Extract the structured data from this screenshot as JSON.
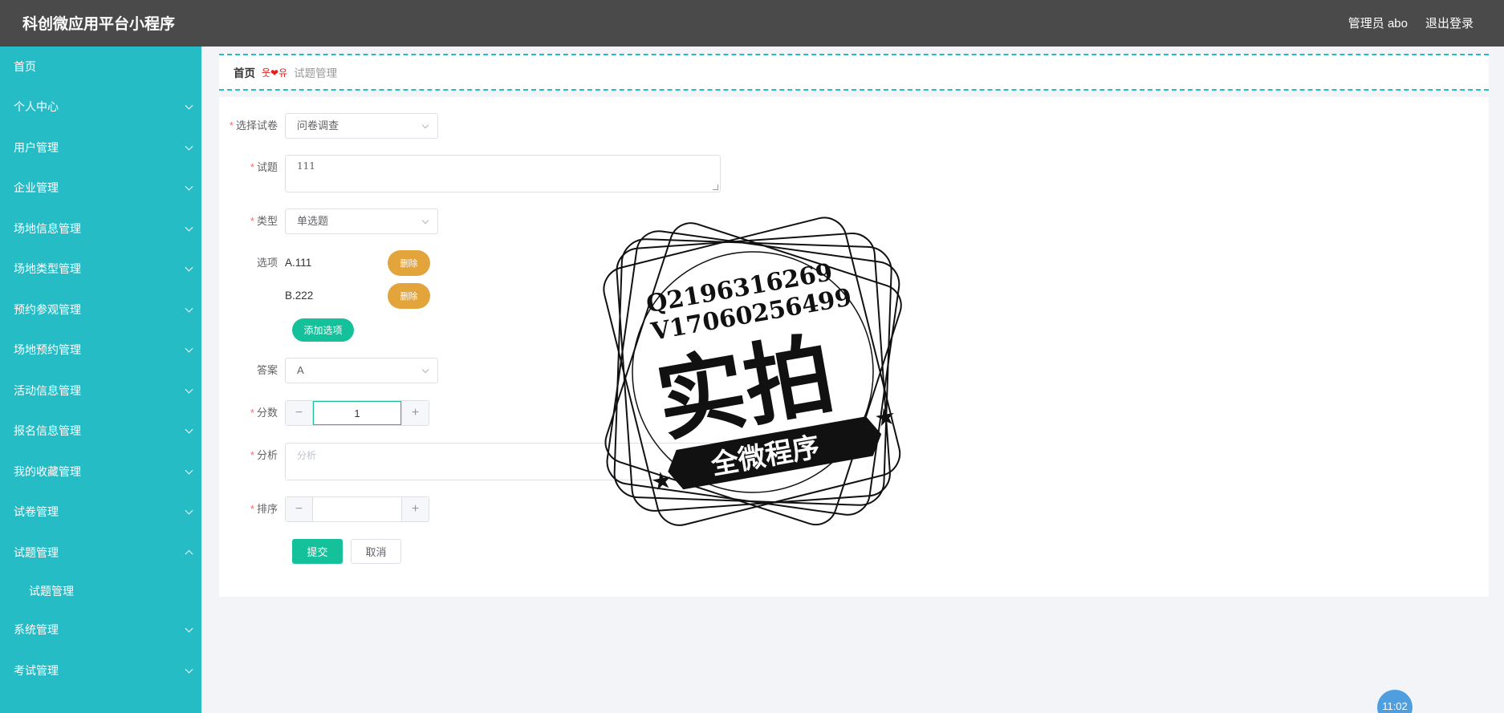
{
  "app": {
    "title": "科创微应用平台小程序"
  },
  "header": {
    "user": "管理员 abo",
    "logout": "退出登录"
  },
  "sidebar": {
    "items": [
      {
        "label": "首页"
      },
      {
        "label": "个人中心"
      },
      {
        "label": "用户管理"
      },
      {
        "label": "企业管理"
      },
      {
        "label": "场地信息管理"
      },
      {
        "label": "场地类型管理"
      },
      {
        "label": "预约参观管理"
      },
      {
        "label": "场地预约管理"
      },
      {
        "label": "活动信息管理"
      },
      {
        "label": "报名信息管理"
      },
      {
        "label": "我的收藏管理"
      },
      {
        "label": "试卷管理"
      },
      {
        "label": "试题管理"
      },
      {
        "label": "试题管理"
      },
      {
        "label": "系统管理"
      },
      {
        "label": "考试管理"
      }
    ]
  },
  "breadcrumb": {
    "home": "首页",
    "sep_left": "웃",
    "sep_right": "유",
    "current": "试题管理"
  },
  "form": {
    "paper": {
      "label": "选择试卷",
      "value": "问卷调查"
    },
    "question": {
      "label": "试题",
      "value": "111"
    },
    "type": {
      "label": "类型",
      "value": "单选题"
    },
    "options": {
      "label": "选项",
      "items": [
        {
          "text": "A.111"
        },
        {
          "text": "B.222"
        }
      ],
      "delete_label": "删除",
      "add_label": "添加选项"
    },
    "answer": {
      "label": "答案",
      "value": "A"
    },
    "score": {
      "label": "分数",
      "value": "1",
      "minus": "−",
      "plus": "+"
    },
    "analysis": {
      "label": "分析",
      "placeholder": "分析"
    },
    "order": {
      "label": "排序",
      "value": "",
      "minus": "−",
      "plus": "+"
    },
    "submit_label": "提交",
    "cancel_label": "取消"
  },
  "watermark": {
    "line1": "Q2196316269",
    "line2": "V17060256499",
    "big_text": "实拍",
    "ribbon_text": "全微程序"
  },
  "clock": {
    "time": "11:02"
  }
}
